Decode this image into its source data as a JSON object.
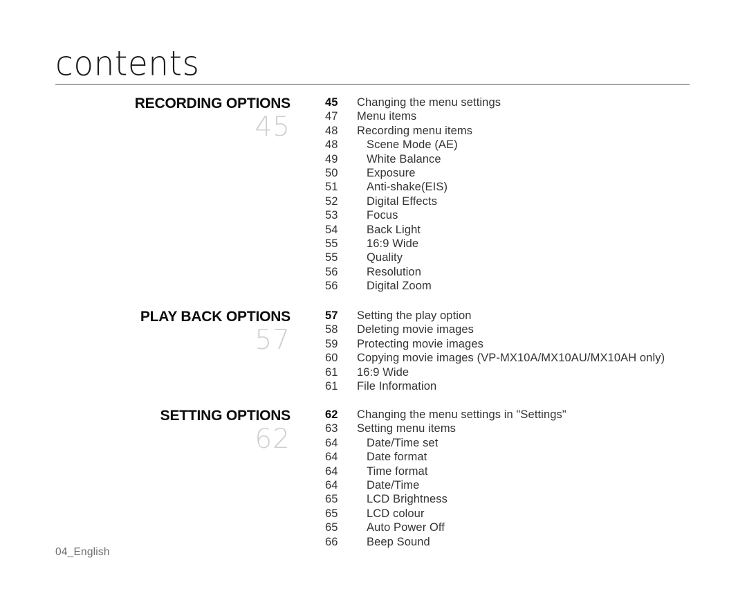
{
  "page": {
    "title": "contents",
    "footer": "04_English",
    "rule_color": "#a8a8a8",
    "big_number_color": "#cfcfcf",
    "body_text_color": "#333333"
  },
  "sections": [
    {
      "heading": "RECORDING OPTIONS",
      "big_number": "45",
      "entries": [
        {
          "page": "45",
          "label": "Changing the menu settings",
          "indent": false,
          "bold": true
        },
        {
          "page": "47",
          "label": "Menu items",
          "indent": false,
          "bold": false
        },
        {
          "page": "48",
          "label": "Recording menu items",
          "indent": false,
          "bold": false
        },
        {
          "page": "48",
          "label": "Scene Mode (AE)",
          "indent": true,
          "bold": false
        },
        {
          "page": "49",
          "label": "White Balance",
          "indent": true,
          "bold": false
        },
        {
          "page": "50",
          "label": "Exposure",
          "indent": true,
          "bold": false
        },
        {
          "page": "51",
          "label": "Anti-shake(EIS)",
          "indent": true,
          "bold": false
        },
        {
          "page": "52",
          "label": "Digital Effects",
          "indent": true,
          "bold": false
        },
        {
          "page": "53",
          "label": "Focus",
          "indent": true,
          "bold": false
        },
        {
          "page": "54",
          "label": "Back Light",
          "indent": true,
          "bold": false
        },
        {
          "page": "55",
          "label": "16:9 Wide",
          "indent": true,
          "bold": false
        },
        {
          "page": "55",
          "label": "Quality",
          "indent": true,
          "bold": false
        },
        {
          "page": "56",
          "label": "Resolution",
          "indent": true,
          "bold": false
        },
        {
          "page": "56",
          "label": "Digital Zoom",
          "indent": true,
          "bold": false
        }
      ]
    },
    {
      "heading": "PLAY BACK OPTIONS",
      "big_number": "57",
      "entries": [
        {
          "page": "57",
          "label": "Setting the play option",
          "indent": false,
          "bold": true
        },
        {
          "page": "58",
          "label": "Deleting movie images",
          "indent": false,
          "bold": false
        },
        {
          "page": "59",
          "label": "Protecting movie images",
          "indent": false,
          "bold": false
        },
        {
          "page": "60",
          "label": "Copying movie images (VP-MX10A/MX10AU/MX10AH only)",
          "indent": false,
          "bold": false
        },
        {
          "page": "61",
          "label": "16:9 Wide",
          "indent": false,
          "bold": false
        },
        {
          "page": "61",
          "label": "File Information",
          "indent": false,
          "bold": false
        }
      ]
    },
    {
      "heading": "SETTING OPTIONS",
      "big_number": "62",
      "entries": [
        {
          "page": "62",
          "label": "Changing the menu settings in \"Settings\"",
          "indent": false,
          "bold": true
        },
        {
          "page": "63",
          "label": "Setting menu items",
          "indent": false,
          "bold": false
        },
        {
          "page": "64",
          "label": "Date/Time set",
          "indent": true,
          "bold": false
        },
        {
          "page": "64",
          "label": "Date format",
          "indent": true,
          "bold": false
        },
        {
          "page": "64",
          "label": "Time format",
          "indent": true,
          "bold": false
        },
        {
          "page": "64",
          "label": "Date/Time",
          "indent": true,
          "bold": false
        },
        {
          "page": "65",
          "label": "LCD Brightness",
          "indent": true,
          "bold": false
        },
        {
          "page": "65",
          "label": "LCD colour",
          "indent": true,
          "bold": false
        },
        {
          "page": "65",
          "label": "Auto Power Off",
          "indent": true,
          "bold": false
        },
        {
          "page": "66",
          "label": "Beep Sound",
          "indent": true,
          "bold": false
        }
      ]
    }
  ]
}
